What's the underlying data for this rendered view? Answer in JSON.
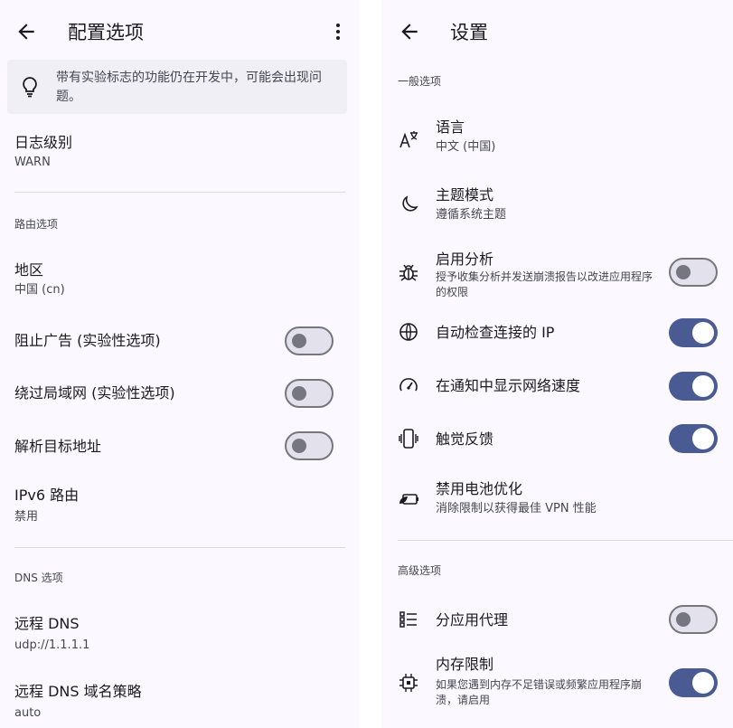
{
  "left": {
    "title": "配置选项",
    "tip": "带有实验标志的功能仍在开发中，可能会出现问题。",
    "log_level": {
      "title": "日志级别",
      "value": "WARN"
    },
    "routing_heading": "路由选项",
    "region": {
      "title": "地区",
      "value": "中国 (cn)"
    },
    "block_ads": {
      "title": "阻止广告 (实验性选项)",
      "on": false
    },
    "bypass_lan": {
      "title": "绕过局域网 (实验性选项)",
      "on": false
    },
    "resolve_dest": {
      "title": "解析目标地址",
      "on": false
    },
    "ipv6_route": {
      "title": "IPv6 路由",
      "value": "禁用"
    },
    "dns_heading": "DNS 选项",
    "remote_dns": {
      "title": "远程 DNS",
      "value": "udp://1.1.1.1"
    },
    "remote_dns_strategy": {
      "title": "远程 DNS 域名策略",
      "value": "auto"
    }
  },
  "right": {
    "title": "设置",
    "general_heading": "一般选项",
    "language": {
      "title": "语言",
      "value": "中文 (中国)",
      "icon": "translate-icon"
    },
    "theme": {
      "title": "主题模式",
      "value": "遵循系统主题",
      "icon": "moon-icon"
    },
    "analytics": {
      "title": "启用分析",
      "value": "授予收集分析并发送崩溃报告以改进应用程序的权限",
      "on": false,
      "icon": "bug-icon"
    },
    "auto_check_ip": {
      "title": "自动检查连接的 IP",
      "on": true,
      "icon": "globe-icon"
    },
    "net_speed": {
      "title": "在通知中显示网络速度",
      "on": true,
      "icon": "speedometer-icon"
    },
    "haptic": {
      "title": "触觉反馈",
      "on": true,
      "icon": "vibration-icon"
    },
    "battery": {
      "title": "禁用电池优化",
      "value": "消除限制以获得最佳 VPN 性能",
      "icon": "battery-leaf-icon"
    },
    "advanced_heading": "高级选项",
    "per_app_proxy": {
      "title": "分应用代理",
      "on": false,
      "icon": "app-list-icon"
    },
    "memory_limit": {
      "title": "内存限制",
      "value": "如果您遇到内存不足错误或频繁应用程序崩溃，请启用",
      "on": true,
      "icon": "chip-icon"
    }
  },
  "colors": {
    "accent": "#4a5a92",
    "surface": "#fbf8ff",
    "tip_bg": "#f0eff6",
    "switch_off": "#767680"
  }
}
